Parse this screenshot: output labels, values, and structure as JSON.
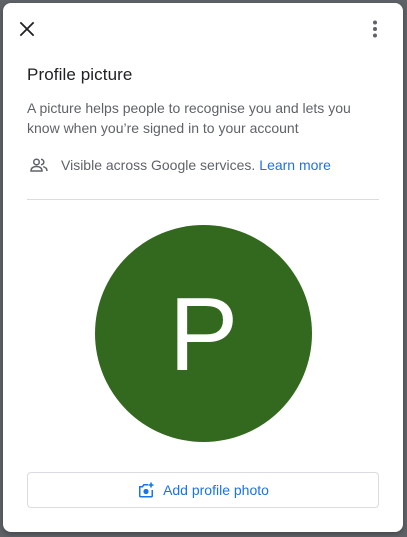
{
  "dialog": {
    "title": "Profile picture",
    "description": "A picture helps people to recognise you and lets you know when you’re signed in to your account",
    "visibility_text": "Visible across Google services.",
    "learn_more": "Learn more",
    "avatar_letter": "P",
    "add_photo_label": "Add profile photo"
  },
  "icons": {
    "close": "close-icon",
    "more": "more-vert-icon",
    "people": "people-icon",
    "add_photo": "add-a-photo-icon"
  },
  "colors": {
    "avatar_bg": "#33691e",
    "link": "#1a73e8",
    "text_primary": "#202124",
    "text_secondary": "#5f6368"
  }
}
